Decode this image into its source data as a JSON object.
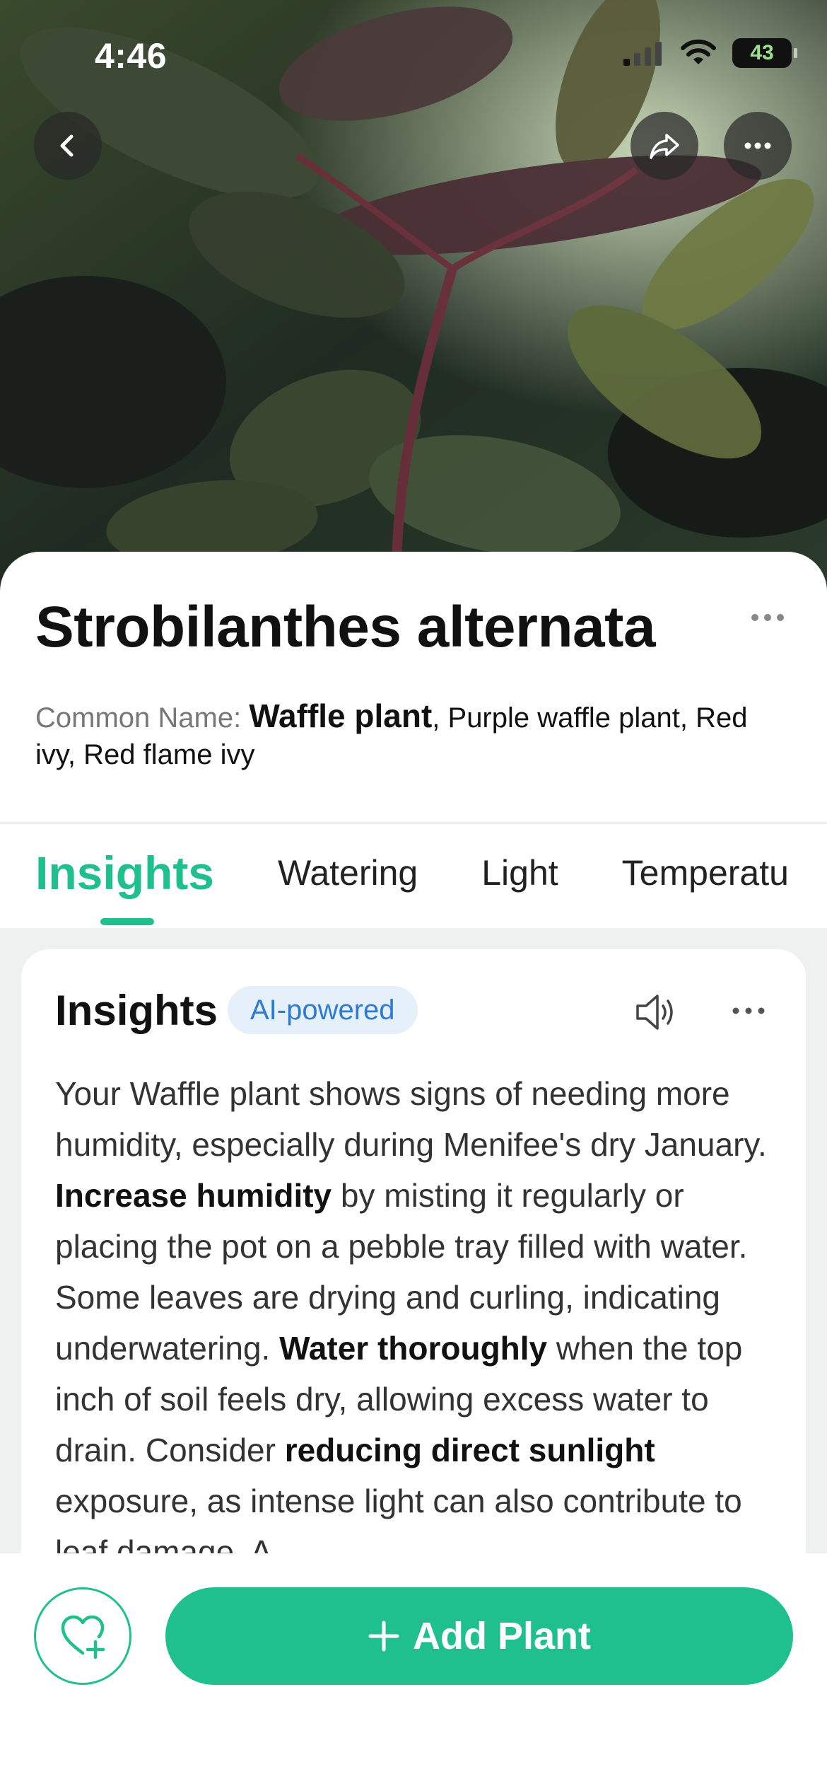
{
  "status_bar": {
    "time": "4:46",
    "battery": "43"
  },
  "plant": {
    "scientific_name": "Strobilanthes alternata",
    "common_name_label": "Common Name:",
    "common_name_primary": "Waffle plant",
    "common_name_others": ", Purple waffle plant, Red ivy, Red flame ivy"
  },
  "tabs": [
    "Insights",
    "Watering",
    "Light",
    "Temperatu"
  ],
  "insights": {
    "title": "Insights",
    "badge": "AI-powered",
    "segments": [
      {
        "text": "Your Waffle plant shows signs of needing more humidity, especially during Menifee's dry January. ",
        "bold": false
      },
      {
        "text": "Increase humidity",
        "bold": true
      },
      {
        "text": " by misting it regularly or placing the pot on a pebble tray filled with water. Some leaves are drying and curling, indicating underwatering. ",
        "bold": false
      },
      {
        "text": "Water thoroughly",
        "bold": true
      },
      {
        "text": " when the top inch of soil feels dry, allowing excess water to drain. Consider ",
        "bold": false
      },
      {
        "text": "reducing direct sunlight",
        "bold": true
      },
      {
        "text": " exposure, as intense light can also contribute to leaf damage. A",
        "bold": false
      }
    ]
  },
  "actions": {
    "add_plant": "Add Plant"
  },
  "icons": {
    "back": "chevron-left-icon",
    "share": "share-arrow-icon",
    "more": "ellipsis-icon",
    "speaker": "speaker-icon",
    "favorite": "heart-plus-icon",
    "add": "plus-icon"
  },
  "colors": {
    "accent": "#20c08e",
    "badge_text": "#2d7bd6",
    "badge_bg": "#e6f0fb"
  }
}
